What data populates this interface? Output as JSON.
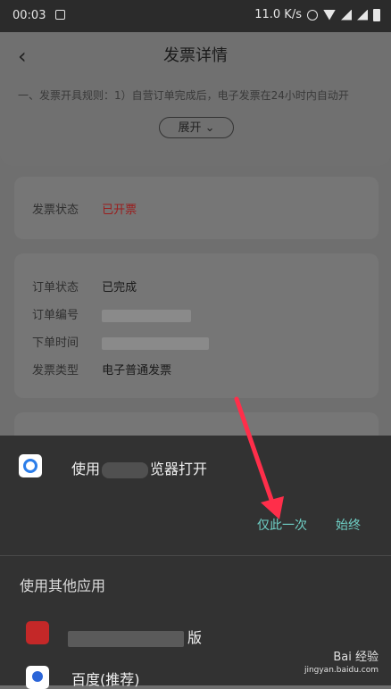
{
  "status_bar": {
    "time": "00:03",
    "speed": "11.0 K/s"
  },
  "header": {
    "title": "发票详情"
  },
  "notice": {
    "text": "一、发票开具规则：1）自营订单完成后，电子发票在24小时内自动开"
  },
  "expand_button": {
    "label": "展开"
  },
  "invoice_status": {
    "key": "发票状态",
    "value": "已开票"
  },
  "order_info": {
    "rows": [
      {
        "key": "订单状态",
        "value": "已完成"
      },
      {
        "key": "订单编号",
        "value": ""
      },
      {
        "key": "下单时间",
        "value": ""
      },
      {
        "key": "发票类型",
        "value": "电子普通发票"
      }
    ]
  },
  "sheet": {
    "open_prefix": "使用",
    "open_suffix": "览器打开",
    "just_once": "仅此一次",
    "always": "始终",
    "other_apps_title": "使用其他应用",
    "app1_suffix": "版",
    "app2_label": "百度(推荐)"
  },
  "watermark": {
    "brand": "Bai 经验",
    "url": "jingyan.baidu.com"
  },
  "colors": {
    "accent": "#6fd0c6",
    "status_red": "#9a1c1c",
    "sheet_bg": "#323232",
    "arrow": "#ff2e4a"
  }
}
